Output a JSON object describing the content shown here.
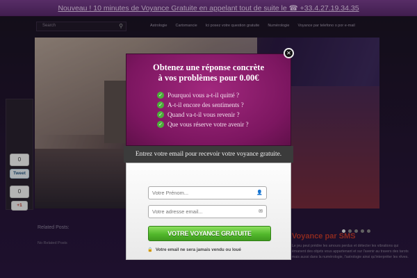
{
  "announcement": "Nouveau ! 10 minutes de Voyance Gratuite en appelant tout de suite le ☎ +33.4.27.19.34.35",
  "search": {
    "placeholder": "Search"
  },
  "nav": [
    "Astrologie",
    "Cartomancie",
    "Ici posez votre question gratuite",
    "Numérologie",
    "Voyance par telefono o por e-mail"
  ],
  "share": {
    "count_top": "0",
    "tweet_label": "Tweet",
    "count_bottom": "0",
    "gplus_label": "+1"
  },
  "related": {
    "heading": "Related Posts:",
    "empty": "No Related Posts"
  },
  "sidebar": {
    "title": "Voyance par SMS",
    "text": "Le jeu peut prédire les amours perdus et détecter les vibrations qui émanent des objets vous appartenant et sur l'avenir au travers des tarots mais aussi dans la numérologie, l'astrologie ainsi qu'interpréter les rêves."
  },
  "modal": {
    "title_line1": "Obtenez une réponse concrète",
    "title_line2": "à vos problèmes pour 0.00€",
    "questions": [
      "Pourquoi vous a-t-il quitté ?",
      "A-t-il encore des sentiments ?",
      "Quand va-t-il vous revenir ?",
      "Que vous réserve votre avenir ?"
    ],
    "banner": "Entrez votre email pour recevoir votre voyance gratuite.",
    "firstname_placeholder": "Votre Prénom...",
    "email_placeholder": "Votre adresse email...",
    "cta_label": "VOTRE VOYANCE GRATUITE",
    "privacy_note": "Votre email ne sera jamais vendu ou loué"
  },
  "colors": {
    "modal_magenta": "#7c1660",
    "cta_green": "#52b82c",
    "topbar_purple": "#6a358001"
  }
}
